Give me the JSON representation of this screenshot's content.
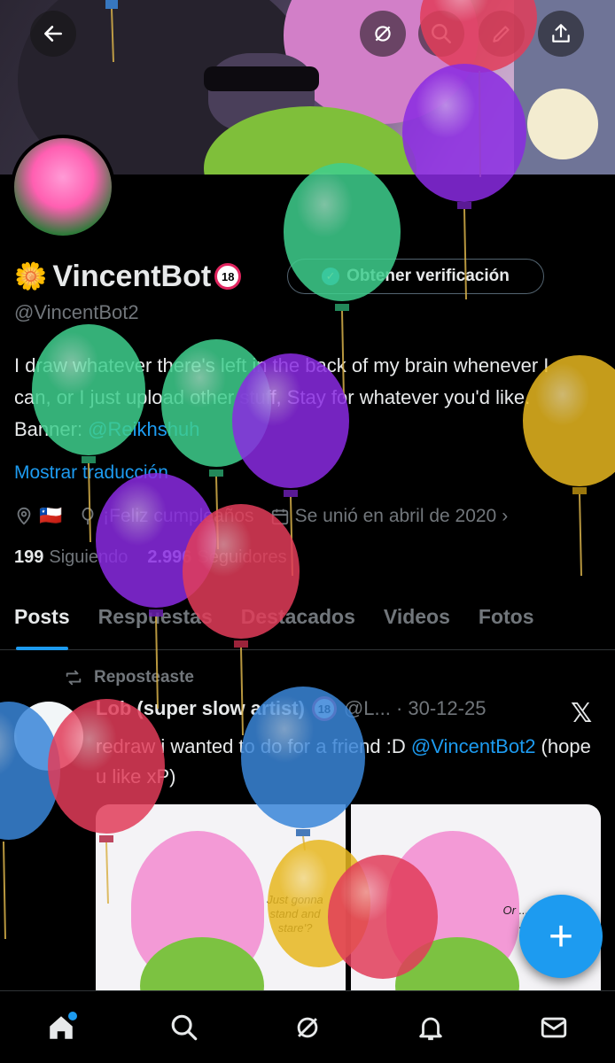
{
  "profile": {
    "display_name": "VincentBot",
    "flower_emoji": "🌼",
    "age_badge": "18",
    "handle": "@VincentBot2",
    "bio_text": "I draw whatever there's left in the back of my brain whenever I can, or I just upload other stuff, Stay for whatever you'd like. Banner: ",
    "bio_link": "@Reikhshuh",
    "translate_label": "Mostrar traducción",
    "location_flag": "🇨🇱",
    "birthday_label": "¡Feliz cumpleaños",
    "joined_label": "Se unió en abril de 2020",
    "following_count": "199",
    "following_label": "Siguiendo",
    "followers_count": "2.996",
    "followers_label": "Seguidores",
    "verify_button": "Obtener verificación"
  },
  "tabs": [
    {
      "label": "Posts"
    },
    {
      "label": "Respuestas"
    },
    {
      "label": "Destacados"
    },
    {
      "label": "Videos"
    },
    {
      "label": "Fotos"
    }
  ],
  "post": {
    "repost_label": "Reposteaste",
    "author": "Lob (super slow artist)",
    "meta": "@L... · 30-12-25",
    "text": "redraw i wanted to do for a friend :D ",
    "mention": "@VincentBot2",
    "text_end": " (hope u like xP)",
    "caption_left": "Just gonna stand and stare'?",
    "caption_right": "Or ... do ..."
  },
  "fab": {
    "label": "+"
  },
  "colors": {
    "accent": "#1d9bf0",
    "background": "#000000",
    "muted": "#71767b",
    "text": "#e7e9ea"
  },
  "icons": {
    "back": "back-arrow-icon",
    "grok": "grok-icon",
    "search": "search-icon",
    "edit": "edit-icon",
    "share": "share-icon",
    "home": "home-icon",
    "notifications": "bell-icon",
    "messages": "mail-icon"
  }
}
